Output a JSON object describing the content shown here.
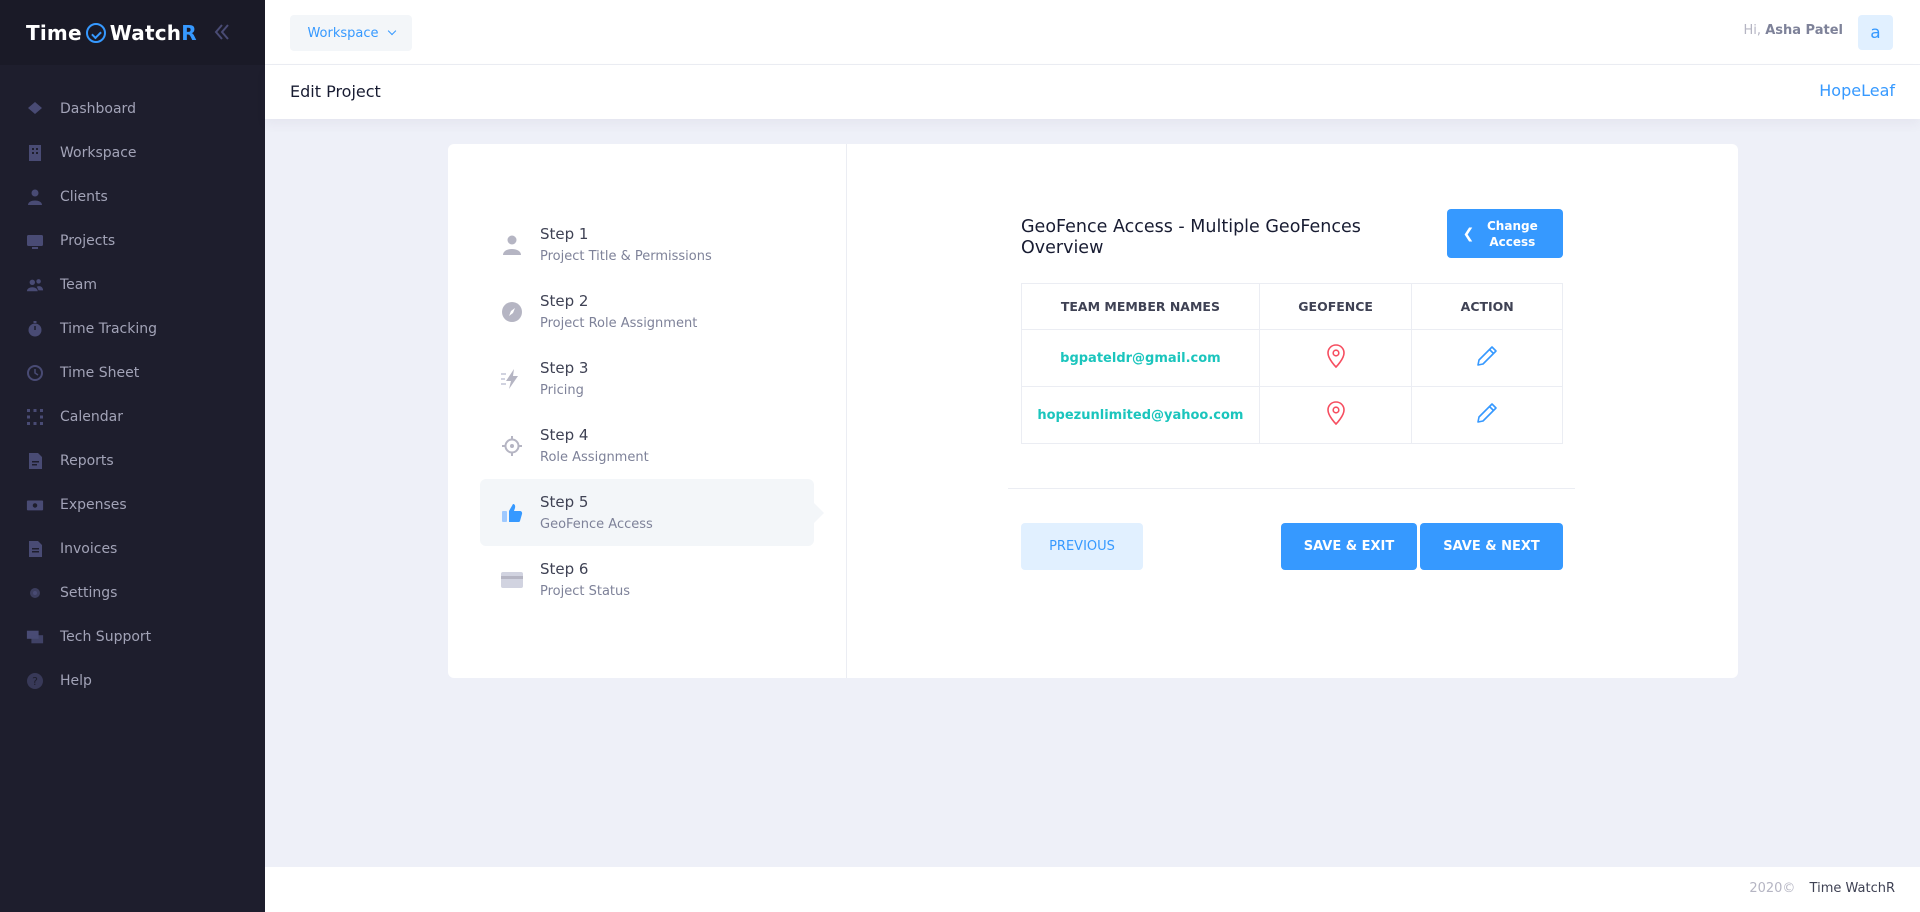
{
  "brand": {
    "part1": "Time",
    "part2": "Watch",
    "part3": "R",
    "collapse_icon": "double-chevron-left-icon"
  },
  "sidebar": {
    "items": [
      {
        "label": "Dashboard",
        "icon": "layers-icon"
      },
      {
        "label": "Workspace",
        "icon": "building-icon"
      },
      {
        "label": "Clients",
        "icon": "user-icon"
      },
      {
        "label": "Projects",
        "icon": "monitor-icon"
      },
      {
        "label": "Team",
        "icon": "group-icon"
      },
      {
        "label": "Time Tracking",
        "icon": "stopwatch-icon"
      },
      {
        "label": "Time Sheet",
        "icon": "clock-icon"
      },
      {
        "label": "Calendar",
        "icon": "calendar-icon"
      },
      {
        "label": "Reports",
        "icon": "document-icon"
      },
      {
        "label": "Expenses",
        "icon": "money-icon"
      },
      {
        "label": "Invoices",
        "icon": "invoice-icon"
      },
      {
        "label": "Settings",
        "icon": "gear-icon"
      },
      {
        "label": "Tech Support",
        "icon": "chat-icon"
      },
      {
        "label": "Help",
        "icon": "question-icon"
      }
    ]
  },
  "header": {
    "workspace_label": "Workspace",
    "greeting": "Hi,",
    "user_name": "Asha Patel",
    "avatar_letter": "a"
  },
  "subheader": {
    "title": "Edit Project",
    "org": "HopeLeaf"
  },
  "steps": [
    {
      "title": "Step 1",
      "desc": "Project Title & Permissions",
      "icon": "user-icon"
    },
    {
      "title": "Step 2",
      "desc": "Project Role Assignment",
      "icon": "compass-icon"
    },
    {
      "title": "Step 3",
      "desc": "Pricing",
      "icon": "lightning-icon"
    },
    {
      "title": "Step 4",
      "desc": "Role Assignment",
      "icon": "target-icon"
    },
    {
      "title": "Step 5",
      "desc": "GeoFence Access",
      "icon": "thumbs-up-icon",
      "active": true
    },
    {
      "title": "Step 6",
      "desc": "Project Status",
      "icon": "credit-card-icon"
    }
  ],
  "geofence": {
    "title": "GeoFence Access - Multiple GeoFences Overview",
    "change_button": "Change Access",
    "columns": [
      "TEAM MEMBER NAMES",
      "GEOFENCE",
      "ACTION"
    ],
    "rows": [
      {
        "email": "bgpateldr@gmail.com"
      },
      {
        "email": "hopezunlimited@yahoo.com"
      }
    ]
  },
  "actions": {
    "previous": "PREVIOUS",
    "save_exit": "SAVE & EXIT",
    "save_next": "SAVE & NEXT"
  },
  "footer": {
    "year": "2020©",
    "app": "Time WatchR"
  },
  "colors": {
    "primary": "#3699ff",
    "sidebar_bg": "#1e1e2d",
    "success": "#1bc5bd",
    "danger": "#f64e60"
  }
}
